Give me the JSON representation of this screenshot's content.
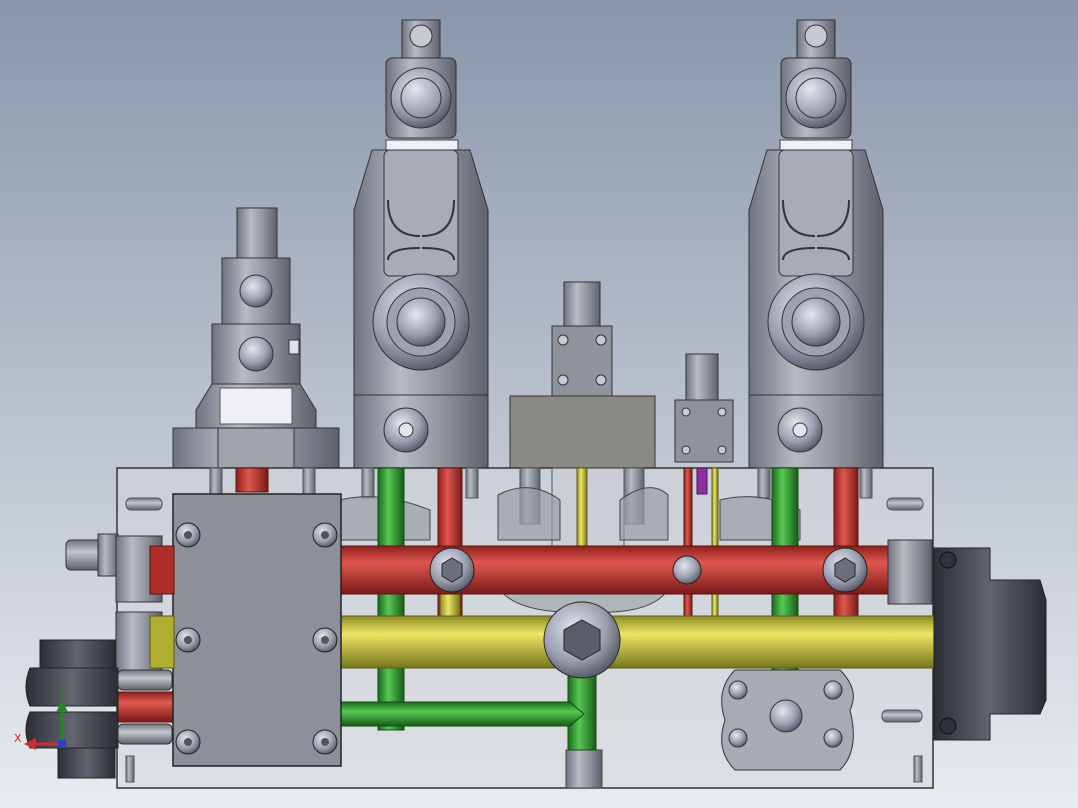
{
  "viewport": {
    "background_top": "#8996ab",
    "background_bottom": "#e9ecef"
  },
  "triad": {
    "x_label": "X",
    "y_label": "Y",
    "x_color": "#d22b2b",
    "y_color": "#1f8a1f",
    "z_color": "#2b3fc8"
  },
  "colors": {
    "block_glass": "#cfd3d8",
    "metal": "#8f939c",
    "metal_light": "#b9bcc3",
    "metal_dark": "#3b3f46",
    "channel_red": "#c7332c",
    "channel_yellow": "#c9c43a",
    "channel_green": "#2f9a30",
    "channel_purple": "#8a2fa0",
    "coupling_dark": "#3a3d44"
  },
  "icons": [
    "triad-icon"
  ]
}
